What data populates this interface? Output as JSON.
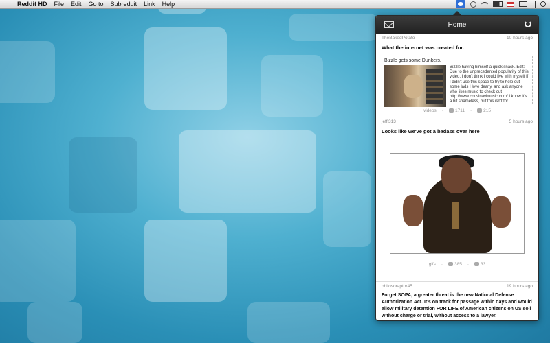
{
  "menubar": {
    "app_name": "Reddit HD",
    "items": [
      "File",
      "Edit",
      "Go to",
      "Subreddit",
      "Link",
      "Help"
    ]
  },
  "popover": {
    "title": "Home",
    "posts": [
      {
        "author": "TheBakedPotato",
        "time": "10 hours ago",
        "title": "What the internet was created for.",
        "embed_title": "Bizzle gets some Dunkers.",
        "embed_text": "Bizzle having himself a quick snack. Edit: Due to the unprecedented popularity of this video, I don't think I could live with myself if I didn't use this space to try to help out some lads I love dearly, and ask anyone who likes music to check out http://www.cousinavimusic.com/ I know it's a bit shameless, but this isn't for",
        "subreddit": "videos",
        "upvotes": "1711",
        "comments": "215"
      },
      {
        "author": "jeffi313",
        "time": "5 hours ago",
        "title": "Looks like we've got a badass over here",
        "subreddit": "gifs",
        "upvotes": "385",
        "comments": "33"
      },
      {
        "author": "philosoraptor45",
        "time": "19 hours ago",
        "title": "Forget SOPA, a greater threat is the new National Defense Authorization Act. It's on track for passage within days and would allow military detention FOR LIFE of American citizens on US soil without charge or trial, without access to a lawyer."
      }
    ]
  }
}
